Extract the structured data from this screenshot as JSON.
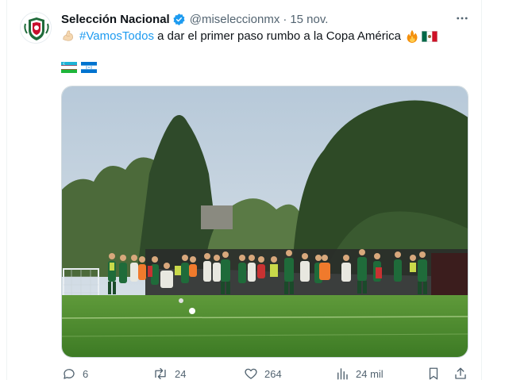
{
  "tweet": {
    "author_name": "Selección Nacional",
    "handle": "@miseleccionmx",
    "separator": "·",
    "date": "15 nov.",
    "text_hashtag": "#VamosTodos",
    "text_body": " a dar el primer paso rumbo a la Copa América",
    "icons": [
      "flexed-biceps-icon",
      "fire-icon",
      "mexico-flag-icon",
      "uzbekistan-flag-icon",
      "honduras-flag-icon"
    ]
  },
  "actions": {
    "replies": "6",
    "reposts": "24",
    "likes": "264",
    "views": "24 mil"
  },
  "colors": {
    "accent": "#1d9bf0",
    "secondary_text": "#536471",
    "field_green": "#3f8a2e",
    "kit_green": "#1f6b3a"
  }
}
